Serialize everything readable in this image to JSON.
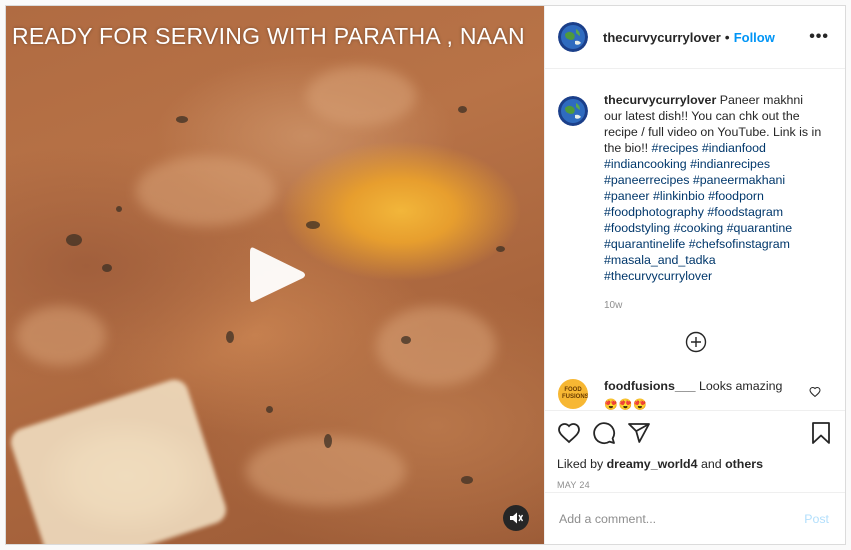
{
  "media": {
    "overlay_text": "READY FOR SERVING WITH PARATHA , NAAN",
    "play_icon": "play-icon",
    "mute_icon": "mute-icon"
  },
  "header": {
    "username": "thecurvycurrylover",
    "separator": "•",
    "follow_label": "Follow",
    "more_icon": "more-options-icon",
    "more_glyph": "•••"
  },
  "caption": {
    "username": "thecurvycurrylover",
    "text": "Paneer makhni our latest dish!! You can chk out the recipe / full video on YouTube. Link is in the bio!!",
    "hashtags": [
      "#recipes",
      "#indianfood",
      "#indiancooking",
      "#indianrecipes",
      "#paneerrecipes",
      "#paneermakhani",
      "#paneer",
      "#linkinbio",
      "#foodporn",
      "#foodphotography",
      "#foodstagram",
      "#foodstyling",
      "#cooking",
      "#quarantine",
      "#quarantinelife",
      "#chefsofinstagram",
      "#masala_and_tadka",
      "#thecurvycurrylover"
    ],
    "time_ago": "10w"
  },
  "load_more_icon": "plus-circle-icon",
  "comments": [
    {
      "username": "foodfusions___",
      "text": "Looks amazing",
      "emojis": "😍😍😍",
      "avatar_text": "FOOD FUSIONS"
    }
  ],
  "actions": {
    "like_icon": "heart-icon",
    "comment_icon": "comment-icon",
    "share_icon": "share-icon",
    "save_icon": "bookmark-icon"
  },
  "likes": {
    "prefix": "Liked by",
    "user": "dreamy_world4",
    "middle": "and",
    "others": "others"
  },
  "date": "MAY 24",
  "add_comment": {
    "placeholder": "Add a comment...",
    "post_label": "Post"
  },
  "colors": {
    "accent_blue": "#0095f6",
    "hashtag": "#00376b",
    "post_disabled": "#b2dffc",
    "muted": "#8e8e8e"
  }
}
